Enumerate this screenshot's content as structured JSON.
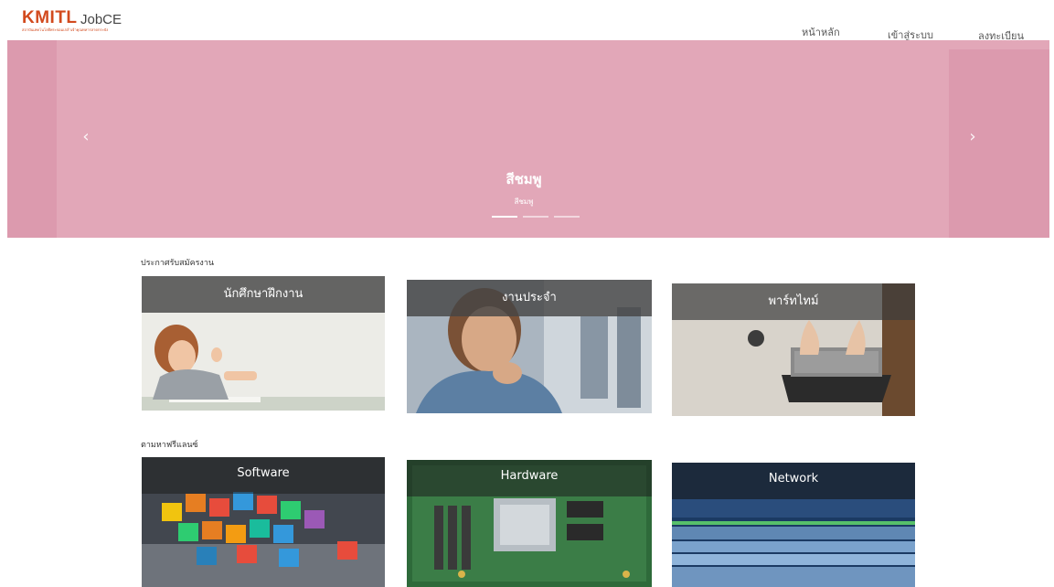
{
  "navbar": {
    "brand_logo": "KMITL",
    "brand_sub": "สถาบันเทคโนโลยีพระจอมเกล้าเจ้าคุณทหารลาดกระบัง",
    "brand_name": "JobCE",
    "links": {
      "home": "หน้าหลัก",
      "login": "เข้าสู่ระบบ",
      "register": "ลงทะเบียน"
    }
  },
  "carousel": {
    "title": "สีชมพู",
    "subtitle": "สีชมพู",
    "prev_icon": "chevron-left-icon",
    "next_icon": "chevron-right-icon",
    "color": "#e2a7b8"
  },
  "sections": {
    "jobs": {
      "title": "ประกาศรับสมัครงาน",
      "cards": {
        "intern": "นักศึกษาฝึกงาน",
        "fulltime": "งานประจำ",
        "parttime": "พาร์ทไทม์"
      }
    },
    "freelance": {
      "title": "ตามหาฟรีแลนซ์",
      "cards": {
        "software": "Software",
        "hardware": "Hardware",
        "network": "Network"
      }
    }
  }
}
